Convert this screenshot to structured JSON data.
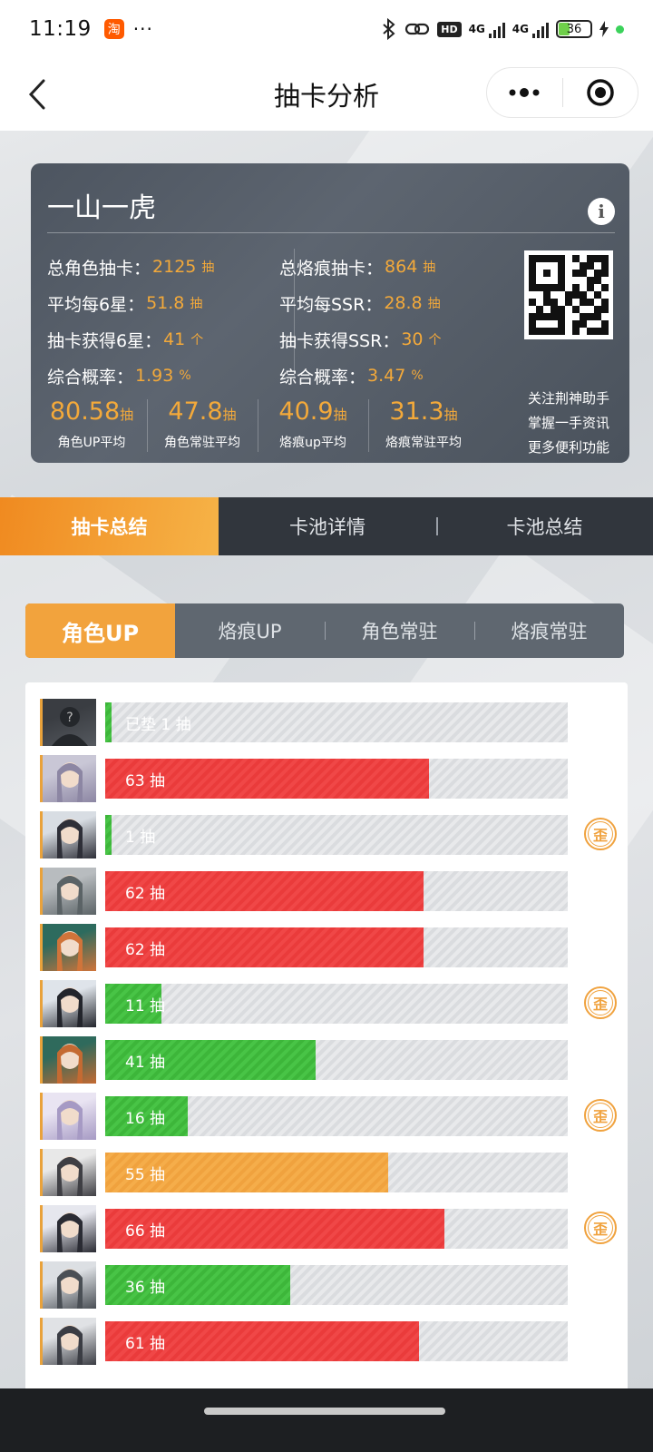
{
  "status_bar": {
    "time": "11:19",
    "taobao_icon": "淘",
    "dots": "···",
    "hd_label": "HD",
    "network_1": "4G",
    "network_2": "4G",
    "battery": "36"
  },
  "nav": {
    "title": "抽卡分析"
  },
  "card": {
    "title": "一山一虎",
    "left_stats": [
      {
        "label": "总角色抽卡：",
        "value": "2125",
        "unit": "抽"
      },
      {
        "label": "平均每6星：",
        "value": "51.8",
        "unit": "抽"
      },
      {
        "label": "抽卡获得6星：",
        "value": "41",
        "unit": "个"
      },
      {
        "label": "综合概率：",
        "value": "1.93",
        "unit": "%"
      }
    ],
    "right_stats": [
      {
        "label": "总烙痕抽卡：",
        "value": "864",
        "unit": "抽"
      },
      {
        "label": "平均每SSR：",
        "value": "28.8",
        "unit": "抽"
      },
      {
        "label": "抽卡获得SSR：",
        "value": "30",
        "unit": "个"
      },
      {
        "label": "综合概率：",
        "value": "3.47",
        "unit": "%"
      }
    ],
    "averages": [
      {
        "value": "80.58",
        "unit": "抽",
        "label": "角色UP平均"
      },
      {
        "value": "47.8",
        "unit": "抽",
        "label": "角色常驻平均"
      },
      {
        "value": "40.9",
        "unit": "抽",
        "label": "烙痕up平均"
      },
      {
        "value": "31.3",
        "unit": "抽",
        "label": "烙痕常驻平均"
      }
    ],
    "promo_lines": [
      "关注荆神助手",
      "掌握一手资讯",
      "更多便利功能"
    ]
  },
  "main_tabs": [
    "抽卡总结",
    "卡池详情",
    "卡池总结"
  ],
  "sub_tabs": [
    "角色UP",
    "烙痕UP",
    "角色常驻",
    "烙痕常驻"
  ],
  "pulls": {
    "max_scale": 90,
    "wai_label": "歪",
    "unknown_avatar_mark": "?",
    "rows": [
      {
        "label": "已垫 1 抽",
        "pulls": 1,
        "color": "green",
        "wai": false,
        "unknown": true,
        "avatar_colors": [
          "#3a3d42",
          "#55595f"
        ]
      },
      {
        "label": "63 抽",
        "pulls": 63,
        "color": "red",
        "wai": false,
        "unknown": false,
        "avatar_colors": [
          "#c9c7d6",
          "#8c86a3"
        ]
      },
      {
        "label": "1 抽",
        "pulls": 1,
        "color": "green",
        "wai": true,
        "unknown": false,
        "avatar_colors": [
          "#d8dde3",
          "#2e2f38"
        ]
      },
      {
        "label": "62 抽",
        "pulls": 62,
        "color": "red",
        "wai": false,
        "unknown": false,
        "avatar_colors": [
          "#b8bcbf",
          "#5b6366"
        ]
      },
      {
        "label": "62 抽",
        "pulls": 62,
        "color": "red",
        "wai": false,
        "unknown": false,
        "avatar_colors": [
          "#2d6b5e",
          "#d0743a"
        ]
      },
      {
        "label": "11 抽",
        "pulls": 11,
        "color": "green",
        "wai": true,
        "unknown": false,
        "avatar_colors": [
          "#dfe4ea",
          "#23252c"
        ]
      },
      {
        "label": "41 抽",
        "pulls": 41,
        "color": "green",
        "wai": false,
        "unknown": false,
        "avatar_colors": [
          "#2f6a5c",
          "#c46a32"
        ]
      },
      {
        "label": "16 抽",
        "pulls": 16,
        "color": "green",
        "wai": true,
        "unknown": false,
        "avatar_colors": [
          "#e9e4f2",
          "#a69ac4"
        ]
      },
      {
        "label": "55 抽",
        "pulls": 55,
        "color": "orange",
        "wai": false,
        "unknown": false,
        "avatar_colors": [
          "#e8e8e8",
          "#3f3f44"
        ]
      },
      {
        "label": "66 抽",
        "pulls": 66,
        "color": "red",
        "wai": true,
        "unknown": false,
        "avatar_colors": [
          "#e6e7ee",
          "#2a2b33"
        ]
      },
      {
        "label": "36 抽",
        "pulls": 36,
        "color": "green",
        "wai": false,
        "unknown": false,
        "avatar_colors": [
          "#dcdfe3",
          "#4a4f55"
        ]
      },
      {
        "label": "61 抽",
        "pulls": 61,
        "color": "red",
        "wai": false,
        "unknown": false,
        "avatar_colors": [
          "#e0e2e5",
          "#3b3d44"
        ]
      }
    ]
  }
}
